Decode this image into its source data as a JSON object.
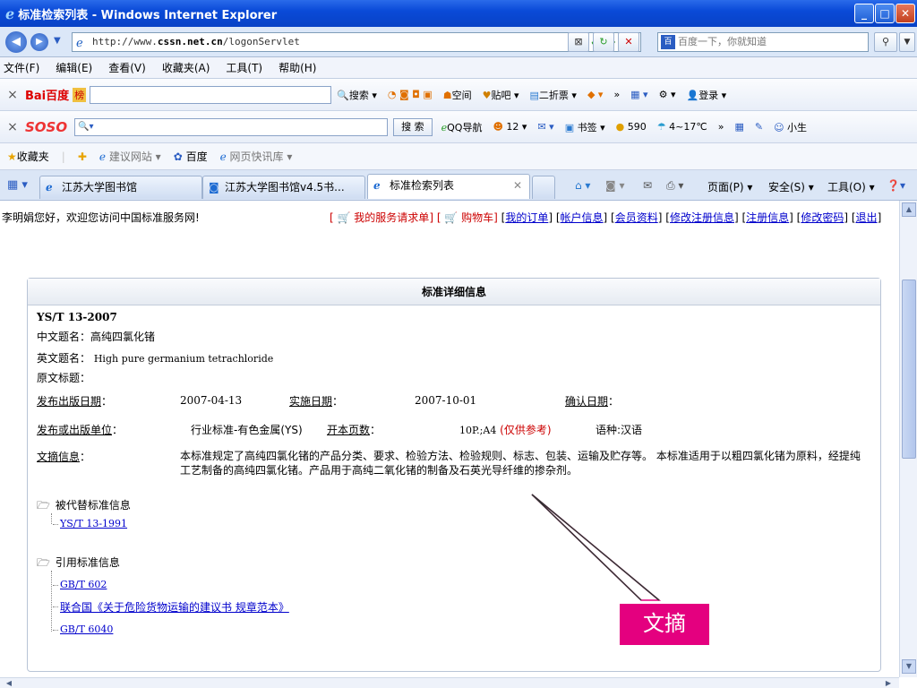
{
  "window": {
    "title": "标准检索列表 - Windows Internet Explorer"
  },
  "address_bar": {
    "url_prefix": "http://www.",
    "url_host": "cssn.net.cn",
    "url_path": "/logonServlet",
    "search_placeholder": "百度一下，你就知道",
    "search_logo": "百"
  },
  "menu": {
    "items": [
      "文件(F)",
      "编辑(E)",
      "查看(V)",
      "收藏夹(A)",
      "工具(T)",
      "帮助(H)"
    ]
  },
  "baidu_toolbar": {
    "logo": "Bai百度",
    "badge": "榜",
    "search_label": "搜索",
    "items": [
      "空间",
      "贴吧",
      "二折票"
    ],
    "login": "登录"
  },
  "soso_toolbar": {
    "logo": "SOSO",
    "search_label": "搜 索",
    "items": [
      "QQ导航",
      "12",
      "书签",
      "590",
      "4~17℃"
    ],
    "user": "小生"
  },
  "favorites_bar": {
    "favorites_label": "收藏夹",
    "items": [
      "建议网站",
      "百度",
      "网页快讯库"
    ]
  },
  "tabs": [
    {
      "label": "江苏大学图书馆"
    },
    {
      "label": "江苏大学图书馆v4.5书..."
    },
    {
      "label": "标准检索列表"
    }
  ],
  "command_bar": {
    "page": "页面(P)",
    "safety": "安全(S)",
    "tools": "工具(O)"
  },
  "page": {
    "welcome": "李明娟您好，欢迎您访问中国标准服务网!",
    "links": {
      "service": "我的服务请求单",
      "cart": "购物车",
      "orders": "我的订单",
      "account": "帐户信息",
      "member": "会员资料",
      "modify_reg": "修改注册信息",
      "reg_info": "注册信息",
      "password": "修改密码",
      "logout": "退出"
    },
    "panel_title": "标准详细信息",
    "std_no": "YS/T 13-2007",
    "cn_title_label": "中文题名：",
    "cn_title": "高纯四氯化锗",
    "en_title_label": "英文题名：",
    "en_title": "High pure germanium tetrachloride",
    "orig_title_label": "原文标题：",
    "publish_date_label": "发布出版日期",
    "publish_date": "2007-04-13",
    "impl_date_label": "实施日期",
    "impl_date": "2007-10-01",
    "confirm_date_label": "确认日期",
    "publisher_label": "发布或出版单位",
    "publisher": "行业标准-有色金属(YS)",
    "pages_label": "开本页数",
    "pages": "10P.;A4",
    "ref_only": "(仅供参考)",
    "language": "语种:汉语",
    "abstract_label": "文摘信息",
    "abstract": "本标准规定了高纯四氯化锗的产品分类、要求、检验方法、检验规则、标志、包装、运输及贮存等。 本标准适用于以粗四氯化锗为原料，经提纯工艺制备的高纯四氯化锗。产品用于高纯二氧化锗的制备及石英光导纤维的掺杂剂。",
    "replaced_label": "被代替标准信息",
    "replaced": [
      "YS/T 13-1991"
    ],
    "refs_label": "引用标准信息",
    "refs": [
      "GB/T 602",
      "联合国《关于危险货物运输的建议书 规章范本》",
      "GB/T 6040"
    ],
    "callout": "文摘"
  }
}
